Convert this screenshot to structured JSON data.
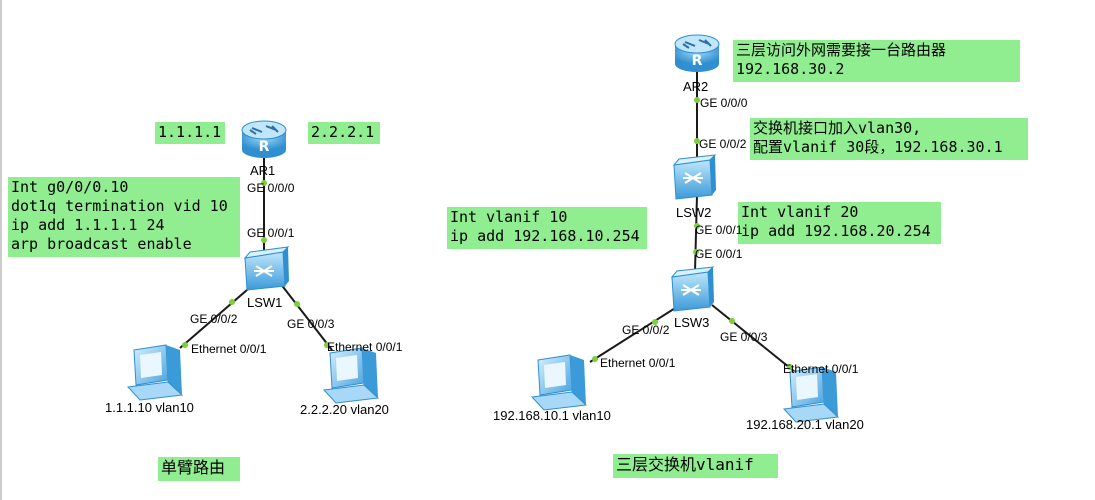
{
  "notes": {
    "ar1_left_ip": "1.1.1.1",
    "ar1_right_ip": "2.2.2.1",
    "ar1_config": "Int g0/0/0.10\ndot1q termination vid 10\nip add 1.1.1.1 24\narp broadcast enable",
    "ar2_note": "三层访问外网需要接一台路由器\n192.168.30.2",
    "lsw2_note": "交换机接口加入vlan30,\n配置vlanif 30段，192.168.30.1",
    "vlanif10": "Int vlanif 10\nip add 192.168.10.254",
    "vlanif20": "Int vlanif 20\nip add 192.168.20.254",
    "title_left": "单臂路由",
    "title_right": "三层交换机vlanif"
  },
  "devices": {
    "ar1": "AR1",
    "lsw1": "LSW1",
    "ar2": "AR2",
    "lsw2": "LSW2",
    "lsw3": "LSW3"
  },
  "ports": {
    "ar1_ge000": "GE 0/0/0",
    "lsw1_ge001": "GE 0/0/1",
    "lsw1_ge002": "GE 0/0/2",
    "lsw1_ge003": "GE 0/0/3",
    "pc1_eth": "Ethernet 0/0/1",
    "pc2_eth": "Ethernet 0/0/1",
    "ar2_ge000": "GE 0/0/0",
    "lsw2_ge002": "GE 0/0/2",
    "lsw2_ge001": "GE 0/0/1",
    "lsw3_ge001": "GE 0/0/1",
    "lsw3_ge002": "GE 0/0/2",
    "lsw3_ge003": "GE 0/0/3",
    "pc3_eth": "Ethernet 0/0/1",
    "pc4_eth": "Ethernet 0/0/1"
  },
  "pcs": {
    "pc1": "1.1.1.10 vlan10",
    "pc2": "2.2.2.20 vlan20",
    "pc3": "192.168.10.1 vlan10",
    "pc4": "192.168.20.1 vlan20"
  },
  "colors": {
    "note_bg": "#90ee90",
    "link": "#1a1a1a",
    "port_dot": "#7ccf3a",
    "device_blue": "#4aa3df"
  }
}
